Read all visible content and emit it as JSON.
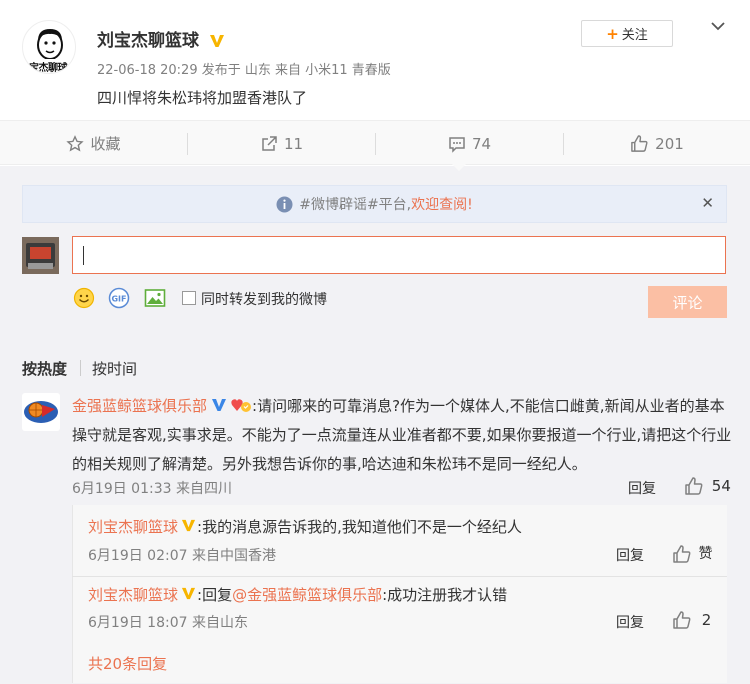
{
  "post": {
    "username": "刘宝杰聊篮球",
    "avatar_text": "宝杰聊球",
    "meta": "22-06-18 20:29 发布于 山东 来自 小米11 青春版",
    "text": "四川悍将朱松玮将加盟香港队了",
    "follow_label": "关注"
  },
  "actions": {
    "favorite": "收藏",
    "repost": "11",
    "comment": "74",
    "like": "201"
  },
  "notice": {
    "text_gray": "#微博辟谣#平台,",
    "text_link": "欢迎查阅!"
  },
  "composer": {
    "repost_label": "同时转发到我的微博",
    "submit_label": "评论"
  },
  "sort": {
    "hot": "按热度",
    "time": "按时间"
  },
  "comment": {
    "author": "金强蓝鲸篮球俱乐部",
    "text": ":请问哪来的可靠消息?作为一个媒体人,不能信口雌黄,新闻从业者的基本操守就是客观,实事求是。不能为了一点流量连从业准者都不要,如果你要报道一个行业,请把这个行业的相关规则了解清楚。另外我想告诉你的事,哈达迪和朱松玮不是同一经纪人。",
    "meta": "6月19日 01:33 来自四川",
    "reply_label": "回复",
    "likes": "54"
  },
  "replies": [
    {
      "author": "刘宝杰聊篮球",
      "prefix": "",
      "mention": "",
      "text": ":我的消息源告诉我的,我知道他们不是一个经纪人",
      "meta": "6月19日 02:07 来自中国香港",
      "reply_label": "回复",
      "likes": "赞"
    },
    {
      "author": "刘宝杰聊篮球",
      "prefix": ":回复",
      "mention": "@金强蓝鲸篮球俱乐部",
      "text": ":成功注册我才认错",
      "meta": "6月19日 18:07 来自山东",
      "reply_label": "回复",
      "likes": "2"
    }
  ],
  "more_replies": "共20条回复",
  "colors": {
    "accent": "#eb7350",
    "vip_gold": "#f7b500",
    "notice_bg": "#e9eef8"
  }
}
